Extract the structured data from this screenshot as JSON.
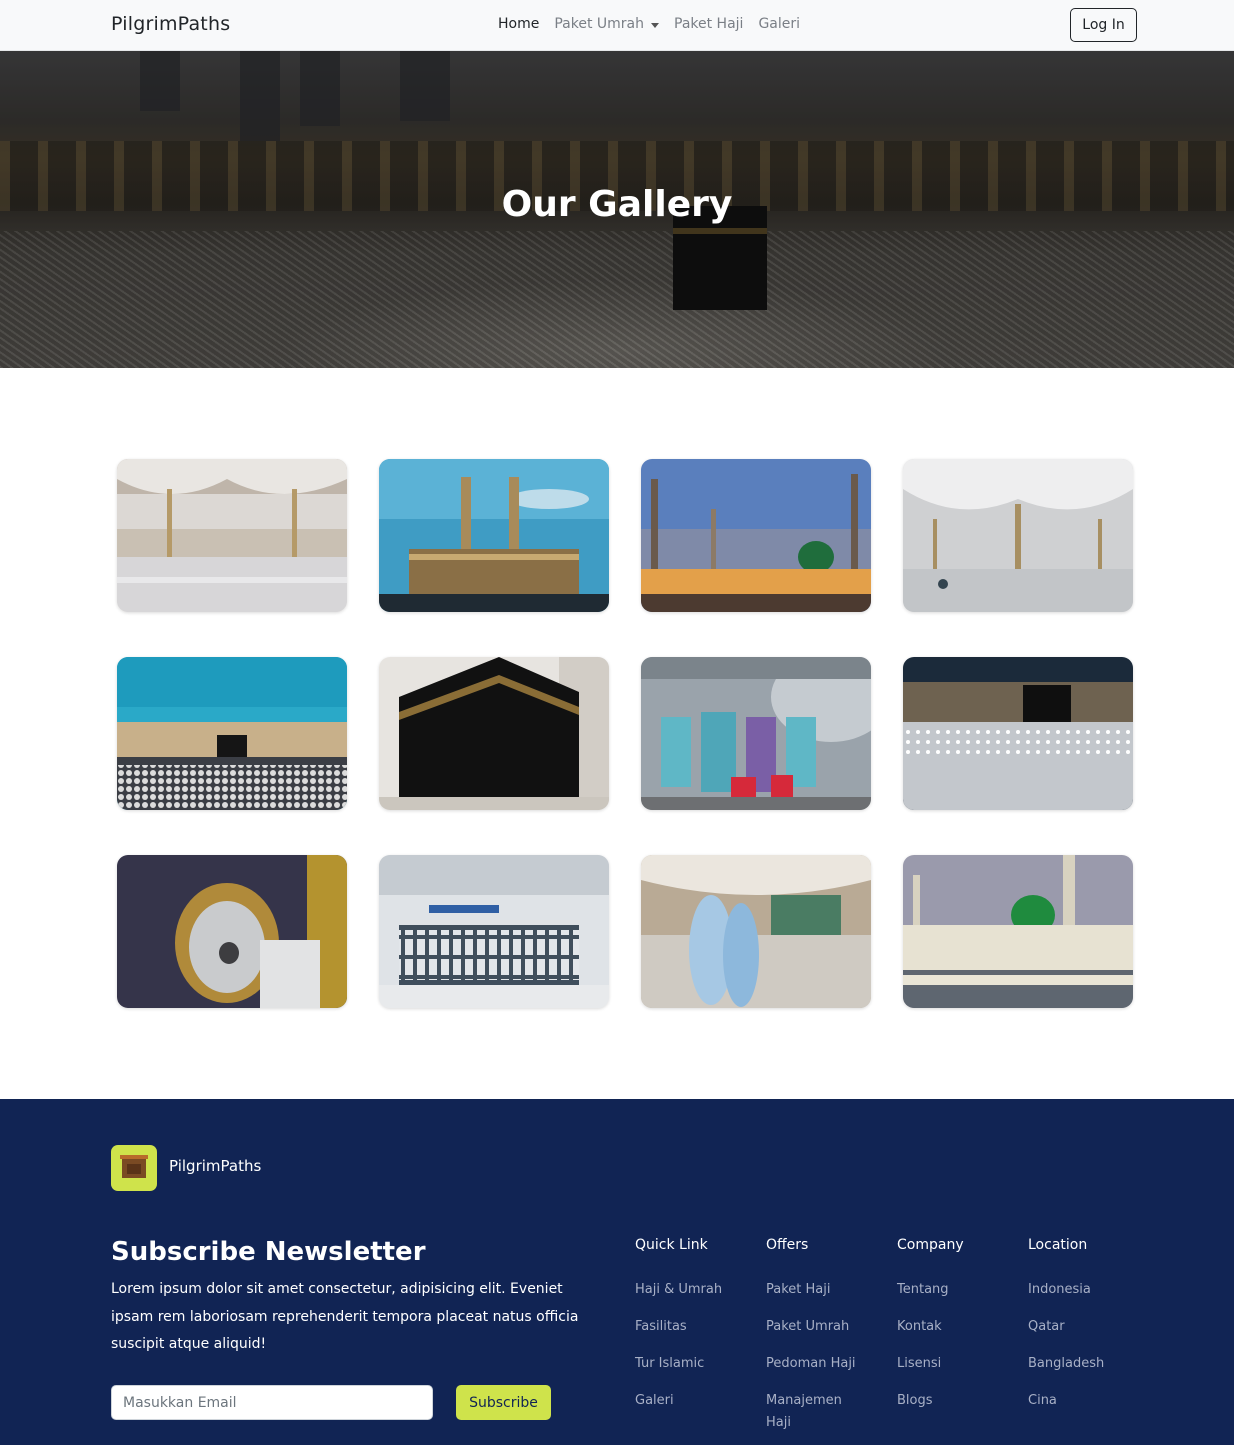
{
  "navbar": {
    "brand": "PilgrimPaths",
    "links": [
      {
        "label": "Home"
      },
      {
        "label": "Paket Umrah"
      },
      {
        "label": "Paket Haji"
      },
      {
        "label": "Galeri"
      }
    ],
    "login_label": "Log In"
  },
  "hero": {
    "title": "Our Gallery"
  },
  "gallery": {
    "photos": [
      {
        "subject": "mosque-umbrellas-courtyard"
      },
      {
        "subject": "mosque-minarets-blue-sky"
      },
      {
        "subject": "green-dome-mosque-sunset"
      },
      {
        "subject": "umbrellas-courtyard-pilgrims"
      },
      {
        "subject": "kaaba-crowd-daytime"
      },
      {
        "subject": "kaaba-closeup"
      },
      {
        "subject": "pilgrims-boarding-plane"
      },
      {
        "subject": "kaaba-night-tawaf"
      },
      {
        "subject": "black-stone-silver-frame"
      },
      {
        "subject": "airport-queue"
      },
      {
        "subject": "pilgrim-women-courtyard"
      },
      {
        "subject": "green-dome-mosque-dusk"
      }
    ]
  },
  "footer": {
    "brand": "PilgrimPaths",
    "logo_icon": "kaaba-icon",
    "newsletter_title": "Subscribe Newsletter",
    "newsletter_text": "Lorem ipsum dolor sit amet consectetur, adipisicing elit. Eveniet ipsam rem laboriosam reprehenderit tempora placeat natus officia suscipit atque aliquid!",
    "email_placeholder": "Masukkan Email",
    "subscribe_label": "Subscribe",
    "columns": [
      {
        "title": "Quick Link",
        "items": [
          "Haji & Umrah",
          "Fasilitas",
          "Tur Islamic",
          "Galeri"
        ]
      },
      {
        "title": "Offers",
        "items": [
          "Paket Haji",
          "Paket Umrah",
          "Pedoman Haji",
          "Manajemen Haji"
        ]
      },
      {
        "title": "Company",
        "items": [
          "Tentang",
          "Kontak",
          "Lisensi",
          "Blogs"
        ]
      },
      {
        "title": "Location",
        "items": [
          "Indonesia",
          "Qatar",
          "Bangladesh",
          "Cina"
        ]
      }
    ]
  },
  "colors": {
    "footer_bg": "#112454",
    "accent": "#cfe34b"
  }
}
